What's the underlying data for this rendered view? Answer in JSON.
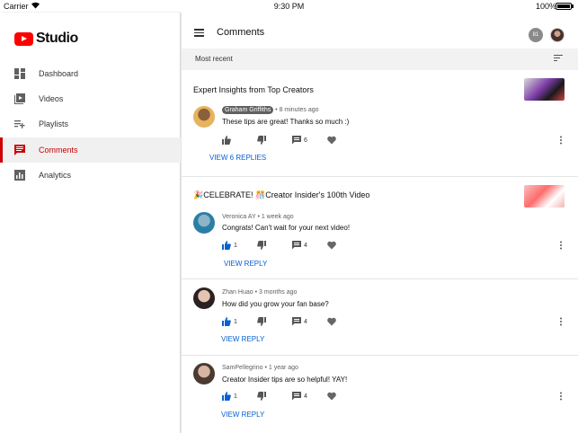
{
  "status": {
    "carrier": "Carrier",
    "time": "9:30 PM",
    "battery": "100%"
  },
  "sidebar": {
    "app_name": "Studio",
    "items": [
      {
        "label": "Dashboard",
        "icon": "dashboard-icon"
      },
      {
        "label": "Videos",
        "icon": "videos-icon"
      },
      {
        "label": "Playlists",
        "icon": "playlists-icon"
      },
      {
        "label": "Comments",
        "icon": "comments-icon",
        "active": true
      },
      {
        "label": "Analytics",
        "icon": "analytics-icon"
      }
    ]
  },
  "header": {
    "title": "Comments",
    "badge": "81"
  },
  "sort": {
    "label": "Most recent"
  },
  "accent": "#cc0000",
  "link_color": "#065fd4",
  "videos": [
    {
      "title": "Expert Insights from Top Creators",
      "comments": [
        {
          "author": "Graham Griffiths",
          "time": "• 8 minutes ago",
          "text": "These tips are great! Thanks so much :)",
          "likes": "",
          "replies": "6",
          "reply_link": "VIEW 6 REPLIES"
        }
      ]
    },
    {
      "title": "🎉CELEBRATE! 🎊Creator Insider's 100th Video",
      "comments": [
        {
          "author": "Veronica AY",
          "time": " • 1 week ago",
          "text": "Congrats! Can't wait for your next video!",
          "likes": "1",
          "replies": "4",
          "reply_link": "VIEW REPLY"
        },
        {
          "author": "Zhan Huao",
          "time": " • 3 months ago",
          "text": "How did you grow your fan base?",
          "likes": "1",
          "replies": "4",
          "reply_link": "VIEW REPLY"
        },
        {
          "author": "SamPellegrino",
          "time": " • 1 year ago",
          "text": "Creator Insider tips are so helpful! YAY!",
          "likes": "1",
          "replies": "4",
          "reply_link": "VIEW REPLY"
        }
      ]
    }
  ]
}
